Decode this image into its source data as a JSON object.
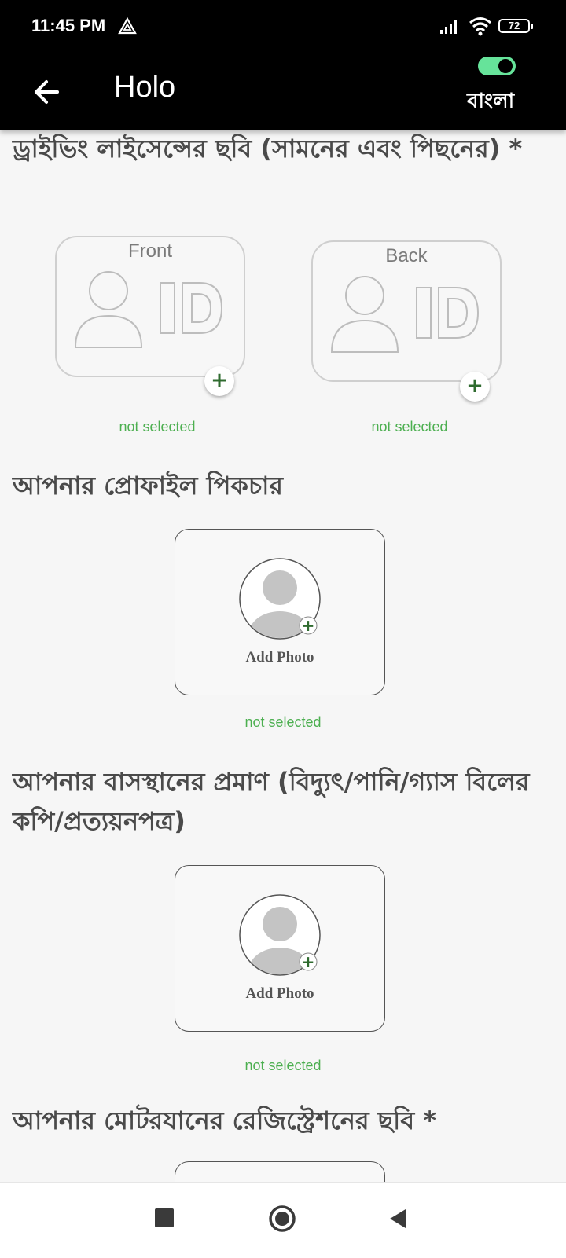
{
  "status_bar": {
    "time": "11:45 PM",
    "battery": "72"
  },
  "app_bar": {
    "title": "Holo",
    "language_label": "বাংলা",
    "language_toggle_on": true,
    "accent_color": "#66e39a"
  },
  "sections": {
    "license": {
      "title": "ড্রাইভিং লাইসেন্সের ছবি (সামনের এবং পিছনের) *",
      "front_label": "Front",
      "back_label": "Back",
      "front_status": "not selected",
      "back_status": "not selected"
    },
    "profile": {
      "title": "আপনার প্রোফাইল পিকচার",
      "button_label": "Add Photo",
      "status": "not selected"
    },
    "residence": {
      "title": "আপনার বাসস্থানের প্রমাণ (বিদ্যুৎ/পানি/গ্যাস বিলের কপি/প্রত্যয়নপত্র)",
      "button_label": "Add Photo",
      "status": "not selected"
    },
    "vehicle": {
      "title": "আপনার মোটরযানের রেজিস্ট্রেশনের ছবি *"
    }
  },
  "icons": {
    "back": "arrow-left-icon",
    "add": "plus-icon",
    "nav_recents": "square-icon",
    "nav_home": "circle-icon",
    "nav_back": "triangle-icon"
  },
  "colors": {
    "status_text": "#4caf50",
    "plus": "#2f6b2f"
  }
}
